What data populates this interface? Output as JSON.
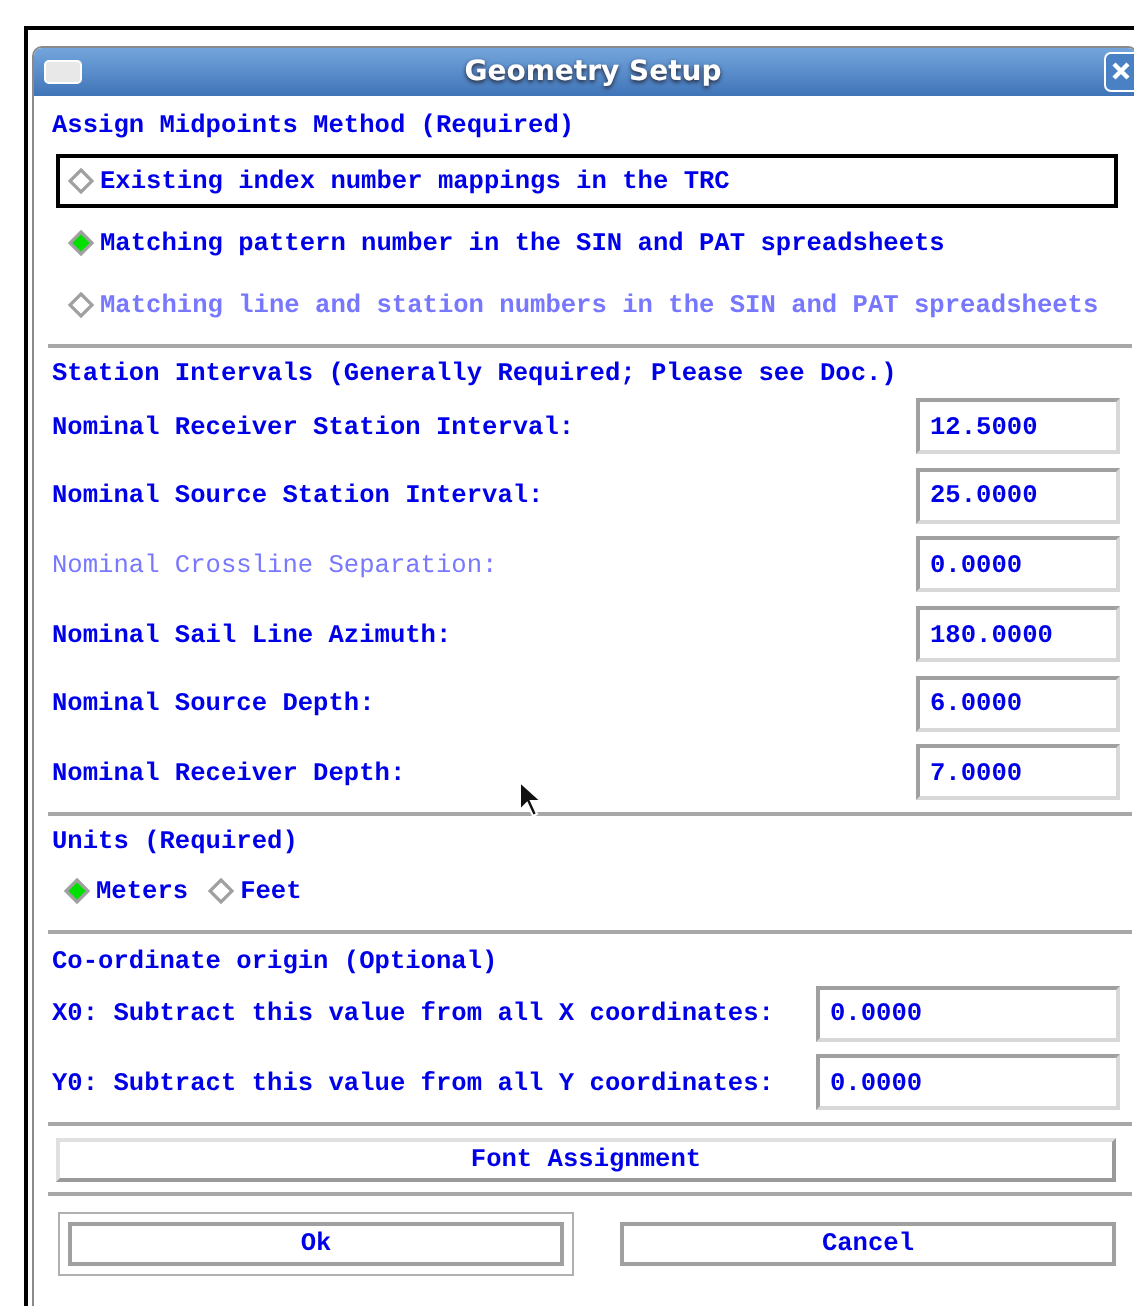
{
  "window": {
    "title": "Geometry Setup"
  },
  "midpoint_method": {
    "heading": "Assign Midpoints Method (Required)",
    "options": [
      {
        "label": "Existing index number mappings in the TRC",
        "selected": false,
        "focused": true,
        "disabled": false
      },
      {
        "label": "Matching pattern number in the SIN and PAT spreadsheets",
        "selected": true,
        "focused": false,
        "disabled": false
      },
      {
        "label": "Matching line and station numbers in the SIN and PAT spreadsheets",
        "selected": false,
        "focused": false,
        "disabled": true
      }
    ]
  },
  "station_intervals": {
    "heading": "Station Intervals (Generally Required; Please see Doc.)",
    "fields": [
      {
        "label": "Nominal Receiver Station Interval:",
        "value": "12.5000",
        "disabled": false
      },
      {
        "label": "Nominal Source Station Interval:",
        "value": "25.0000",
        "disabled": false
      },
      {
        "label": "Nominal Crossline Separation:",
        "value": "0.0000",
        "disabled": true
      },
      {
        "label": "Nominal Sail Line Azimuth:",
        "value": "180.0000",
        "disabled": false
      },
      {
        "label": "Nominal Source Depth:",
        "value": "6.0000",
        "disabled": false
      },
      {
        "label": "Nominal Receiver Depth:",
        "value": "7.0000",
        "disabled": false
      }
    ]
  },
  "units": {
    "heading": "Units (Required)",
    "options": [
      {
        "label": "Meters",
        "selected": true
      },
      {
        "label": "Feet",
        "selected": false
      }
    ]
  },
  "origin": {
    "heading": "Co-ordinate origin (Optional)",
    "fields": [
      {
        "label": "X0: Subtract this value from all X coordinates:",
        "value": "0.0000"
      },
      {
        "label": "Y0: Subtract this value from all Y coordinates:",
        "value": "0.0000"
      }
    ]
  },
  "font_button": "Font Assignment",
  "buttons": [
    {
      "label": "Ok",
      "focused": true
    },
    {
      "label": "Cancel",
      "focused": false
    }
  ]
}
